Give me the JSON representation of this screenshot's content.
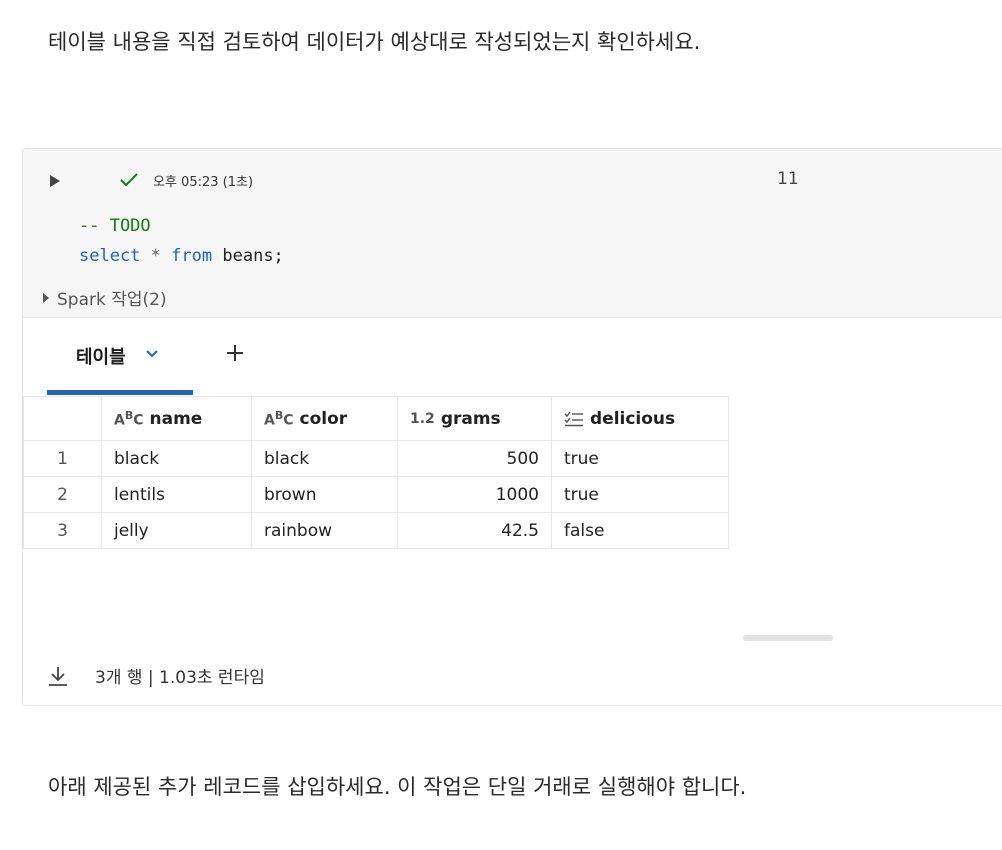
{
  "paragraphs": {
    "top": "테이블 내용을 직접 검토하여 데이터가 예상대로 작성되었는지 확인하세요.",
    "bottom": "아래 제공된 추가 레코드를 삽입하세요. 이 작업은 단일 거래로 실행해야 합니다."
  },
  "cell": {
    "status": "오후 05:23 (1초)",
    "number": "11",
    "code": {
      "comment": "-- TODO",
      "kw_select": "select",
      "star": "*",
      "kw_from": "from",
      "table": "beans;"
    },
    "spark_label": "Spark 작업(2)",
    "tabs": {
      "table_label": "테이블"
    },
    "columns": [
      {
        "type": "ABC",
        "name": "name"
      },
      {
        "type": "ABC",
        "name": "color"
      },
      {
        "type": "1.2",
        "name": "grams"
      },
      {
        "type": "checklist",
        "name": "delicious"
      }
    ],
    "rows": [
      {
        "idx": "1",
        "name": "black",
        "color": "black",
        "grams": "500",
        "delicious": "true"
      },
      {
        "idx": "2",
        "name": "lentils",
        "color": "brown",
        "grams": "1000",
        "delicious": "true"
      },
      {
        "idx": "3",
        "name": "jelly",
        "color": "rainbow",
        "grams": "42.5",
        "delicious": "false"
      }
    ],
    "footer": "3개 행  |  1.03초 런타임"
  },
  "colors": {
    "accent": "#1f67b3",
    "success": "#107c10",
    "keyword": "#1a62c7"
  },
  "icons": [
    "run-icon",
    "checkmark-icon",
    "chevron-down-icon",
    "plus-icon",
    "download-icon"
  ]
}
